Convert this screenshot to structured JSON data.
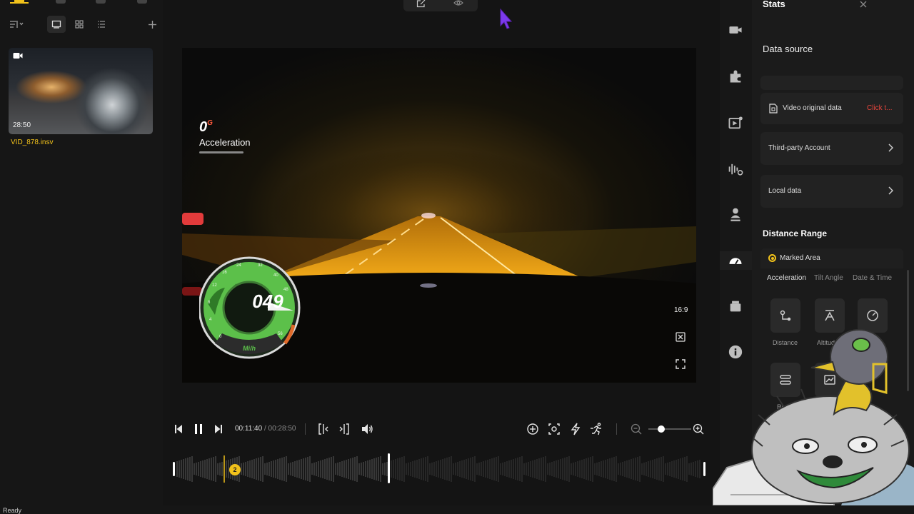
{
  "library": {
    "items": [
      {
        "duration": "28:50",
        "filename": "VID_878.insv"
      }
    ]
  },
  "player": {
    "overlay": {
      "acceleration_value": "0",
      "acceleration_unit": "G",
      "acceleration_label": "Acceleration",
      "speed_value": "049",
      "speed_unit": "Mi/h",
      "gauge_ticks": [
        "0",
        "4",
        "8",
        "12",
        "16",
        "24",
        "32",
        "40",
        "48",
        "56"
      ]
    },
    "aspect_ratio": "16:9",
    "time_current": "00:11:40",
    "time_separator": "/",
    "time_total": "00:28:50",
    "timeline_marker": "2",
    "zoom_level": 0.3
  },
  "stats_panel": {
    "title": "Stats",
    "data_source_label": "Data source",
    "sources": [
      {
        "label": "Video original data",
        "action": "Click t..."
      },
      {
        "label": "Third-party Account"
      },
      {
        "label": "Local data"
      }
    ],
    "distance_range_label": "Distance Range",
    "marked_area_label": "Marked Area",
    "tabs": [
      "Acceleration",
      "Tilt Angle",
      "Date & Time"
    ],
    "active_tab": "Acceleration",
    "tiles": [
      "Distance",
      "Altitude",
      "",
      "Rou"
    ]
  },
  "status_bar": {
    "text": "Ready"
  },
  "colors": {
    "accent": "#f2c21b",
    "link_red": "#e8453c",
    "background": "#141414",
    "panel": "#1b1b1b"
  }
}
